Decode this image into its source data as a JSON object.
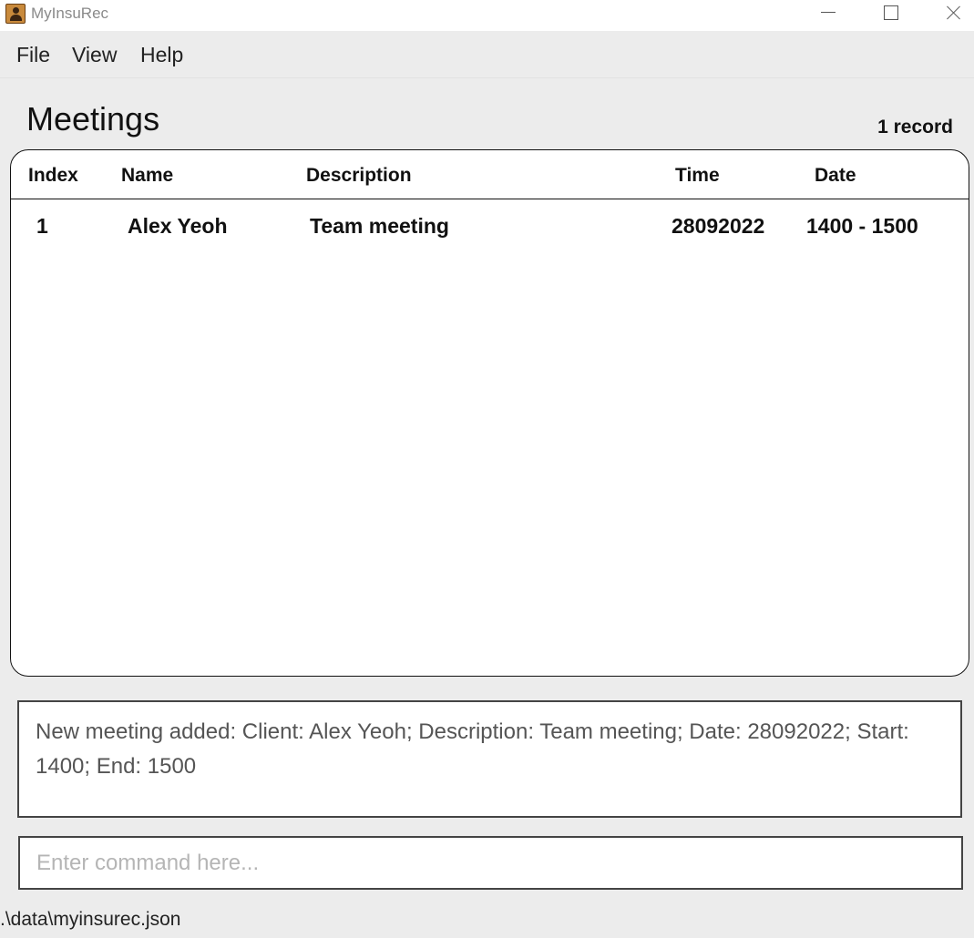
{
  "window": {
    "title": "MyInsuRec",
    "icon": "app-contact-book-icon"
  },
  "menu": {
    "items": [
      "File",
      "View",
      "Help"
    ]
  },
  "meetings": {
    "title": "Meetings",
    "record_count": "1 record",
    "columns": [
      "Index",
      "Name",
      "Description",
      "Time",
      "Date"
    ],
    "rows": [
      {
        "index": "1",
        "name": "Alex Yeoh",
        "description": "Team meeting",
        "time": "28092022",
        "date": "1400 - 1500"
      }
    ]
  },
  "result": {
    "text": "New meeting added: Client: Alex Yeoh; Description: Team meeting; Date: 28092022; Start: 1400; End: 1500"
  },
  "command": {
    "value": "",
    "placeholder": "Enter command here..."
  },
  "status": {
    "path": ".\\data\\myinsurec.json"
  }
}
